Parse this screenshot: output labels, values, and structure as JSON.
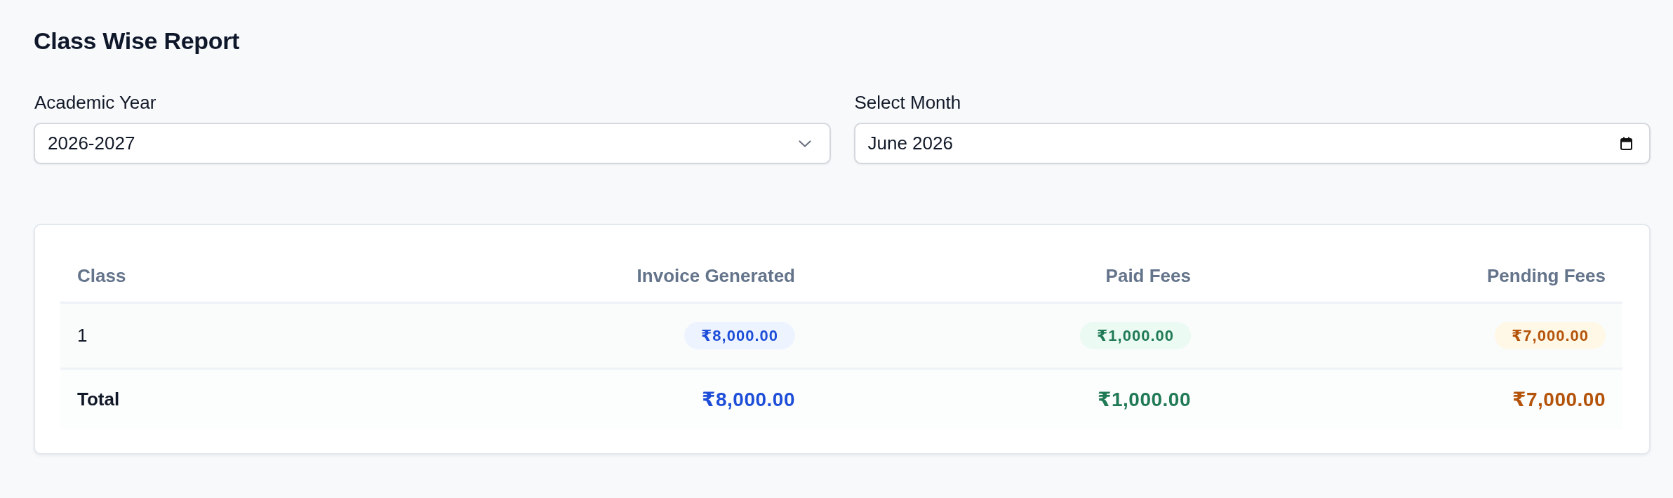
{
  "page": {
    "title": "Class Wise Report"
  },
  "filters": [
    {
      "kind": "select",
      "label": "Academic Year",
      "value": "2026-2027"
    },
    {
      "kind": "month",
      "label": "Select Month",
      "value": "June 2026"
    }
  ],
  "table": {
    "columns": [
      {
        "label": "Class"
      },
      {
        "label": "Invoice Generated"
      },
      {
        "label": "Paid Fees"
      },
      {
        "label": "Pending Fees"
      }
    ],
    "rows": [
      {
        "cells": [
          "1",
          "₹8,000.00",
          "₹1,000.00",
          "₹7,000.00"
        ]
      }
    ],
    "total": {
      "cells": [
        "Total",
        "₹8,000.00",
        "₹1,000.00",
        "₹7,000.00"
      ]
    }
  }
}
